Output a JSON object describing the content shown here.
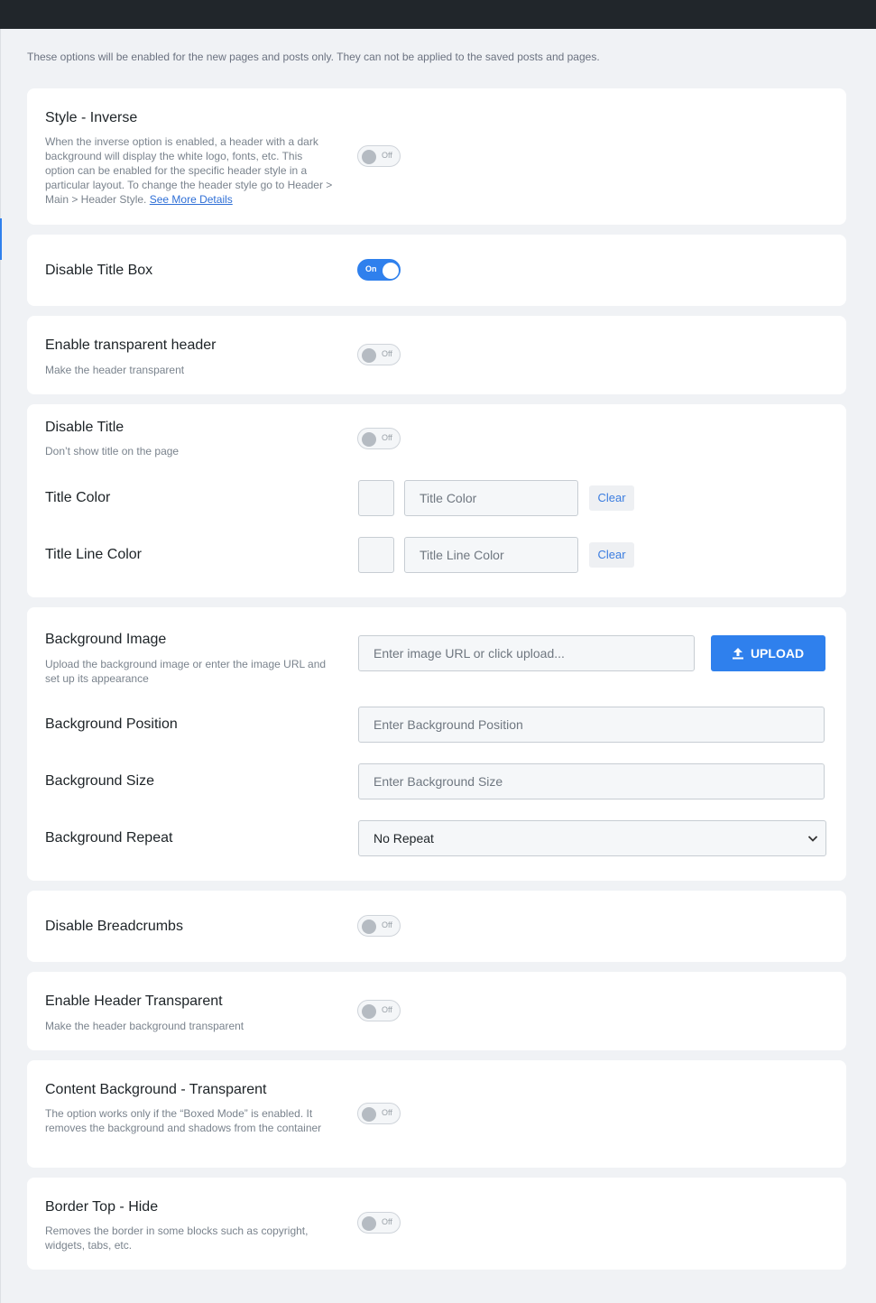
{
  "notice": "These options will be enabled for the new pages and posts only. They can not be applied to the saved posts and pages.",
  "colors": {
    "accent": "#2f80ed",
    "topbar": "#21262b",
    "page_bg": "#f0f2f5",
    "card_bg": "#ffffff"
  },
  "toggles": {
    "on_label": "On",
    "off_label": "Off"
  },
  "style_inverse": {
    "title": "Style - Inverse",
    "desc": "When the inverse option is enabled, a header with a dark background will display the white logo, fonts, etc. This option can be enabled for the specific header style in a particular layout. To change the header style go to Header > Main > Header Style.",
    "link": "See More Details",
    "state": "Off"
  },
  "disable_title_box": {
    "title": "Disable Title Box",
    "state": "On"
  },
  "enable_transparent_header": {
    "title": "Enable transparent header",
    "desc": "Make the header transparent",
    "state": "Off"
  },
  "disable_title": {
    "title": "Disable Title",
    "desc": "Don’t show title on the page",
    "state": "Off"
  },
  "title_color": {
    "label": "Title Color",
    "placeholder": "Title Color",
    "clear": "Clear"
  },
  "title_line_color": {
    "label": "Title Line Color",
    "placeholder": "Title Line Color",
    "clear": "Clear"
  },
  "background_image": {
    "title": "Background Image",
    "desc": "Upload the background image or enter the image URL and set up its appearance",
    "placeholder": "Enter image URL or click upload...",
    "upload": "UPLOAD",
    "upload_icon": "upload-icon"
  },
  "background_position": {
    "label": "Background Position",
    "placeholder": "Enter Background Position"
  },
  "background_size": {
    "label": "Background Size",
    "placeholder": "Enter Background Size"
  },
  "background_repeat": {
    "label": "Background Repeat",
    "selected": "No Repeat"
  },
  "disable_breadcrumbs": {
    "title": "Disable Breadcrumbs",
    "state": "Off"
  },
  "enable_header_transparent": {
    "title": "Enable Header Transparent",
    "desc": "Make the header background transparent",
    "state": "Off"
  },
  "content_bg_transparent": {
    "title": "Content Background - Transparent",
    "desc": "The option works only if the “Boxed Mode” is enabled. It removes the background and shadows from the container",
    "state": "Off"
  },
  "border_top_hide": {
    "title": "Border Top - Hide",
    "desc": "Removes the border in some blocks such as copyright, widgets, tabs, etc.",
    "state": "Off"
  }
}
